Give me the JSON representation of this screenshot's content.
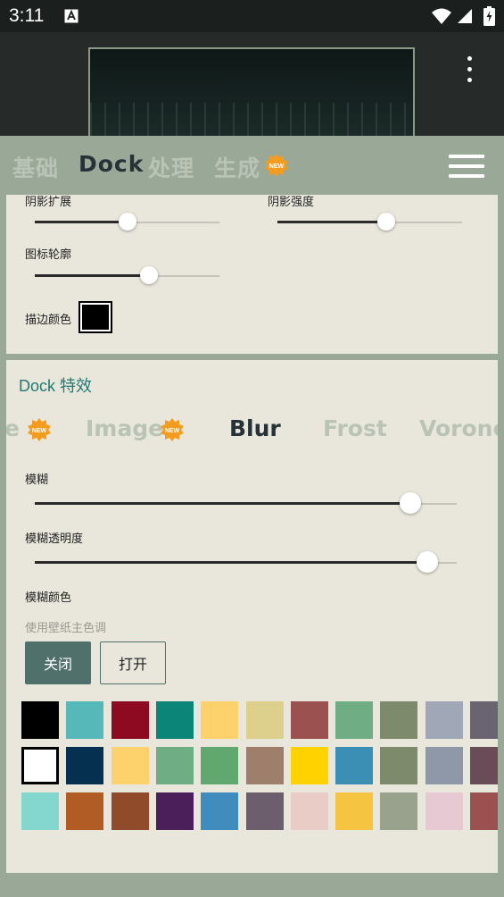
{
  "status_bar": {
    "time": "3:11"
  },
  "tabs": [
    {
      "label": "基础",
      "active": false,
      "new": false
    },
    {
      "label": "Dock",
      "active": true,
      "new": false
    },
    {
      "label": "处理",
      "active": false,
      "new": false
    },
    {
      "label": "生成",
      "active": false,
      "new": true
    }
  ],
  "badge_text": "NEW",
  "shadow": {
    "expand_label": "阴影扩展",
    "expand_value": 0.5,
    "strength_label": "阴影强度",
    "strength_value": 0.59,
    "outline_label": "图标轮廓",
    "outline_value": 0.62,
    "stroke_color_label": "描边颜色",
    "stroke_color": "#000000"
  },
  "dock_effects": {
    "title": "Dock 特效",
    "tabs": [
      {
        "label": "e",
        "active": false,
        "new": true
      },
      {
        "label": "Image",
        "active": false,
        "new": true
      },
      {
        "label": "Blur",
        "active": true,
        "new": false
      },
      {
        "label": "Frost",
        "active": false,
        "new": false
      },
      {
        "label": "Vorono",
        "active": false,
        "new": false
      }
    ],
    "blur_label": "模糊",
    "blur_value": 0.89,
    "blur_alpha_label": "模糊透明度",
    "blur_alpha_value": 0.93,
    "blur_color_label": "模糊颜色",
    "wallpaper_hint": "使用壁纸主色调",
    "off_label": "关闭",
    "on_label": "打开"
  },
  "palette": [
    [
      "#000000",
      "#56b8b8",
      "#8d0a20",
      "#0c8579",
      "#fdd26c",
      "#ddd08c",
      "#9a5150",
      "#6fad85",
      "#7e8a6c",
      "#a0a8b8",
      "#6a6470"
    ],
    [
      "#ffffff",
      "#05304f",
      "#fdd26c",
      "#6fad85",
      "#60a870",
      "#9d7f6c",
      "#ffd200",
      "#3b8fb5",
      "#7e8a6c",
      "#8e98a8",
      "#6a4c58"
    ],
    [
      "#84d7cf",
      "#b05c24",
      "#8f4b2a",
      "#4b1f5a",
      "#3f8cbd",
      "#6c5e6c",
      "#e8ccc5",
      "#f5c542",
      "#98a28c",
      "#e7c9d4",
      "#9a5150"
    ]
  ],
  "selected_swatch": [
    1,
    0
  ]
}
